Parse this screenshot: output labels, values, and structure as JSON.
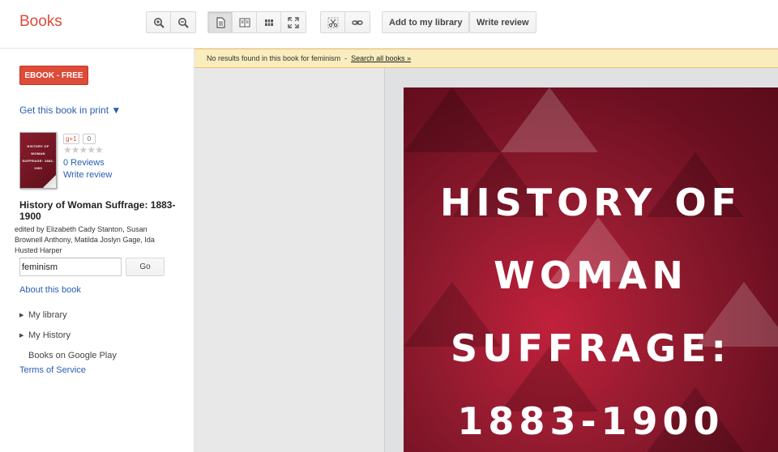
{
  "header": {
    "brand": "Books",
    "add_library_label": "Add to my library",
    "write_review_label": "Write review"
  },
  "sidebar": {
    "ebook_label": "EBOOK - FREE",
    "get_print_label": "Get this book in print ▼",
    "thumb_text": "HISTORY OF WOMAN SUFFRAGE: 1883-1900",
    "gplus_label": "g+1",
    "gplus_count": "0",
    "stars": "★★★★★",
    "reviews_label": "0 Reviews",
    "write_review_label": "Write review",
    "book_title": "History of Woman Suffrage: 1883-1900",
    "book_authors": "edited by Elizabeth Cady Stanton, Susan Brownell Anthony, Matilda Joslyn Gage, Ida Husted Harper",
    "search_value": "feminism",
    "go_label": "Go",
    "about_label": "About this book",
    "nav_items": [
      {
        "label": "My library"
      },
      {
        "label": "My History"
      }
    ],
    "play_label": "Books on Google Play",
    "tos_label": "Terms of Service"
  },
  "main": {
    "notice_text": "No results found in this book for feminism",
    "notice_sep": "-",
    "notice_link": "Search all books »",
    "cover_lines": [
      "HISTORY OF",
      "WOMAN",
      "SUFFRAGE:",
      "1883-1900"
    ]
  },
  "colors": {
    "brand": "#dd4b39",
    "link": "#2a5db0",
    "notice_bg": "#f9edbe",
    "cover": "#8f1a2e"
  },
  "icons": [
    "zoom-in-icon",
    "zoom-out-icon",
    "single-page-icon",
    "two-page-icon",
    "thumbnail-grid-icon",
    "fullscreen-icon",
    "clip-icon",
    "link-icon"
  ]
}
